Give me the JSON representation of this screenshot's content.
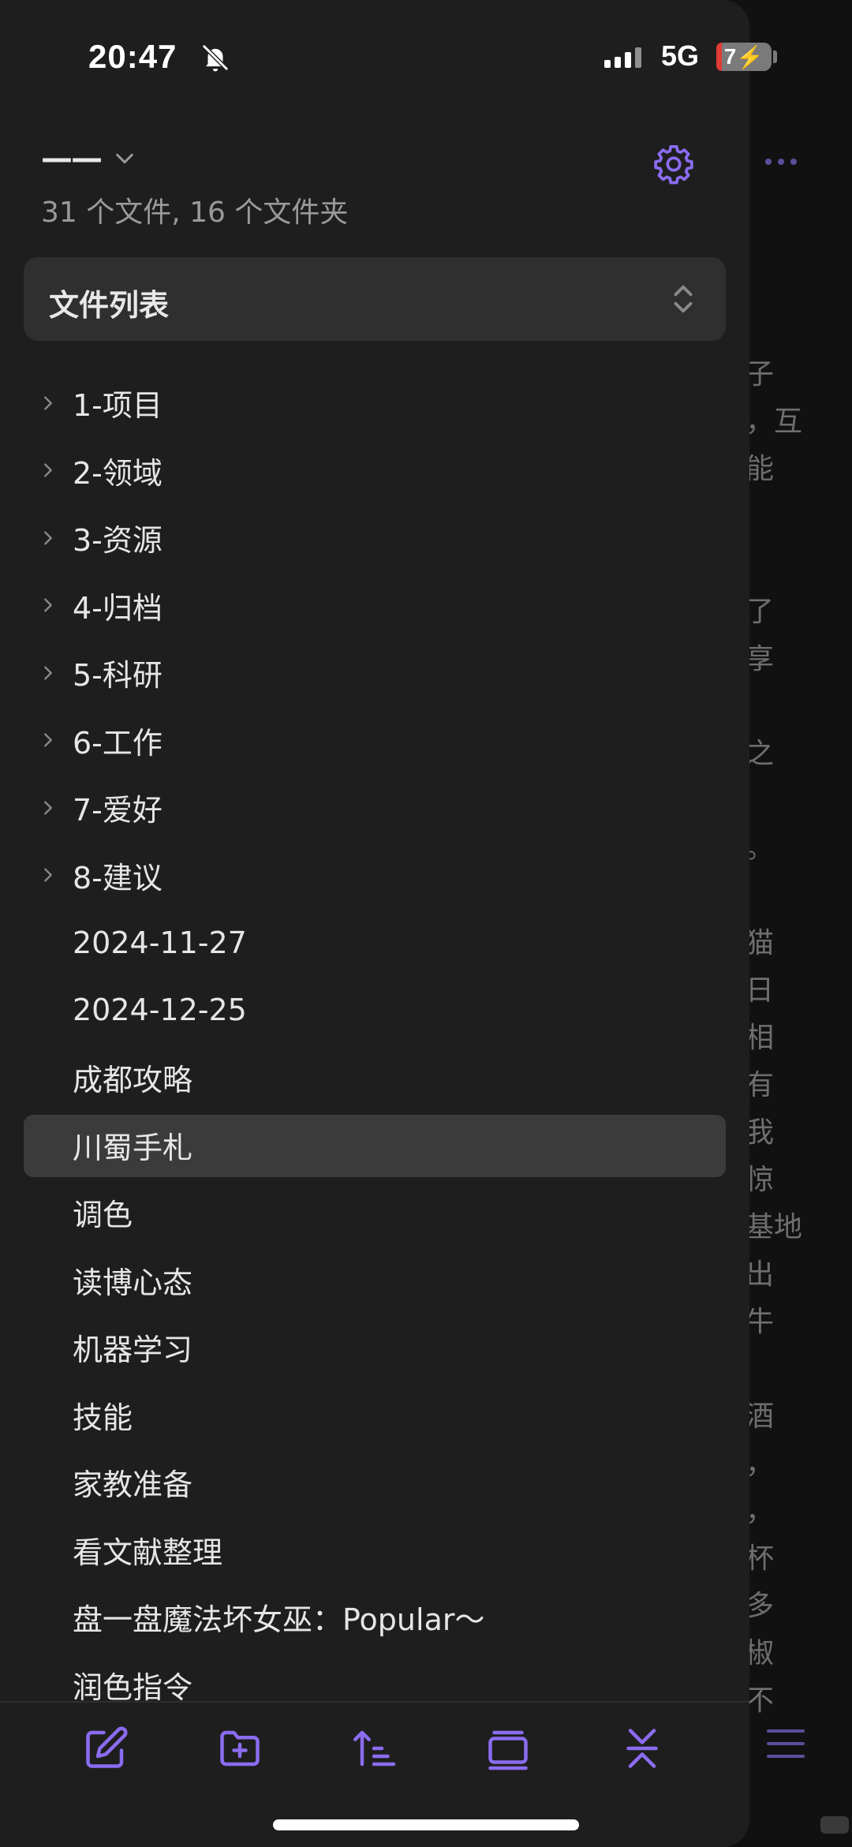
{
  "status": {
    "time": "20:47",
    "network": "5G",
    "battery": "7"
  },
  "vault": {
    "name": "——",
    "counts": "31 个文件, 16 个文件夹"
  },
  "sort": {
    "label": "文件列表"
  },
  "tree": [
    {
      "label": "1-项目",
      "folder": true
    },
    {
      "label": "2-领域",
      "folder": true
    },
    {
      "label": "3-资源",
      "folder": true
    },
    {
      "label": "4-归档",
      "folder": true
    },
    {
      "label": "5-科研",
      "folder": true
    },
    {
      "label": "6-工作",
      "folder": true
    },
    {
      "label": "7-爱好",
      "folder": true
    },
    {
      "label": "8-建议",
      "folder": true
    },
    {
      "label": "2024-11-27",
      "folder": false
    },
    {
      "label": "2024-12-25",
      "folder": false
    },
    {
      "label": "成都攻略",
      "folder": false
    },
    {
      "label": "川蜀手札",
      "folder": false,
      "selected": true
    },
    {
      "label": "调色",
      "folder": false
    },
    {
      "label": "读博心态",
      "folder": false
    },
    {
      "label": "机器学习",
      "folder": false
    },
    {
      "label": "技能",
      "folder": false
    },
    {
      "label": "家教准备",
      "folder": false
    },
    {
      "label": "看文献整理",
      "folder": false
    },
    {
      "label": "盘一盘魔法坏女巫：Popular～",
      "folder": false
    },
    {
      "label": "润色指令",
      "folder": false
    }
  ],
  "background_text": [
    "子",
    "，互",
    "能",
    "了",
    "享",
    "之",
    "。",
    "猫",
    "日",
    "相",
    "有",
    "我",
    "惊",
    "基地",
    "出",
    "牛",
    "酒",
    "，",
    "，",
    "杯",
    "多",
    "椒",
    "不"
  ],
  "toolbar": {
    "icons": [
      "new-note-icon",
      "new-folder-icon",
      "sort-order-icon",
      "auto-reveal-icon",
      "collapse-all-icon"
    ]
  },
  "colors": {
    "accent": "#8b6cf0",
    "drawer_bg": "#1e1e1e",
    "selected_bg": "#3b3b3b"
  }
}
